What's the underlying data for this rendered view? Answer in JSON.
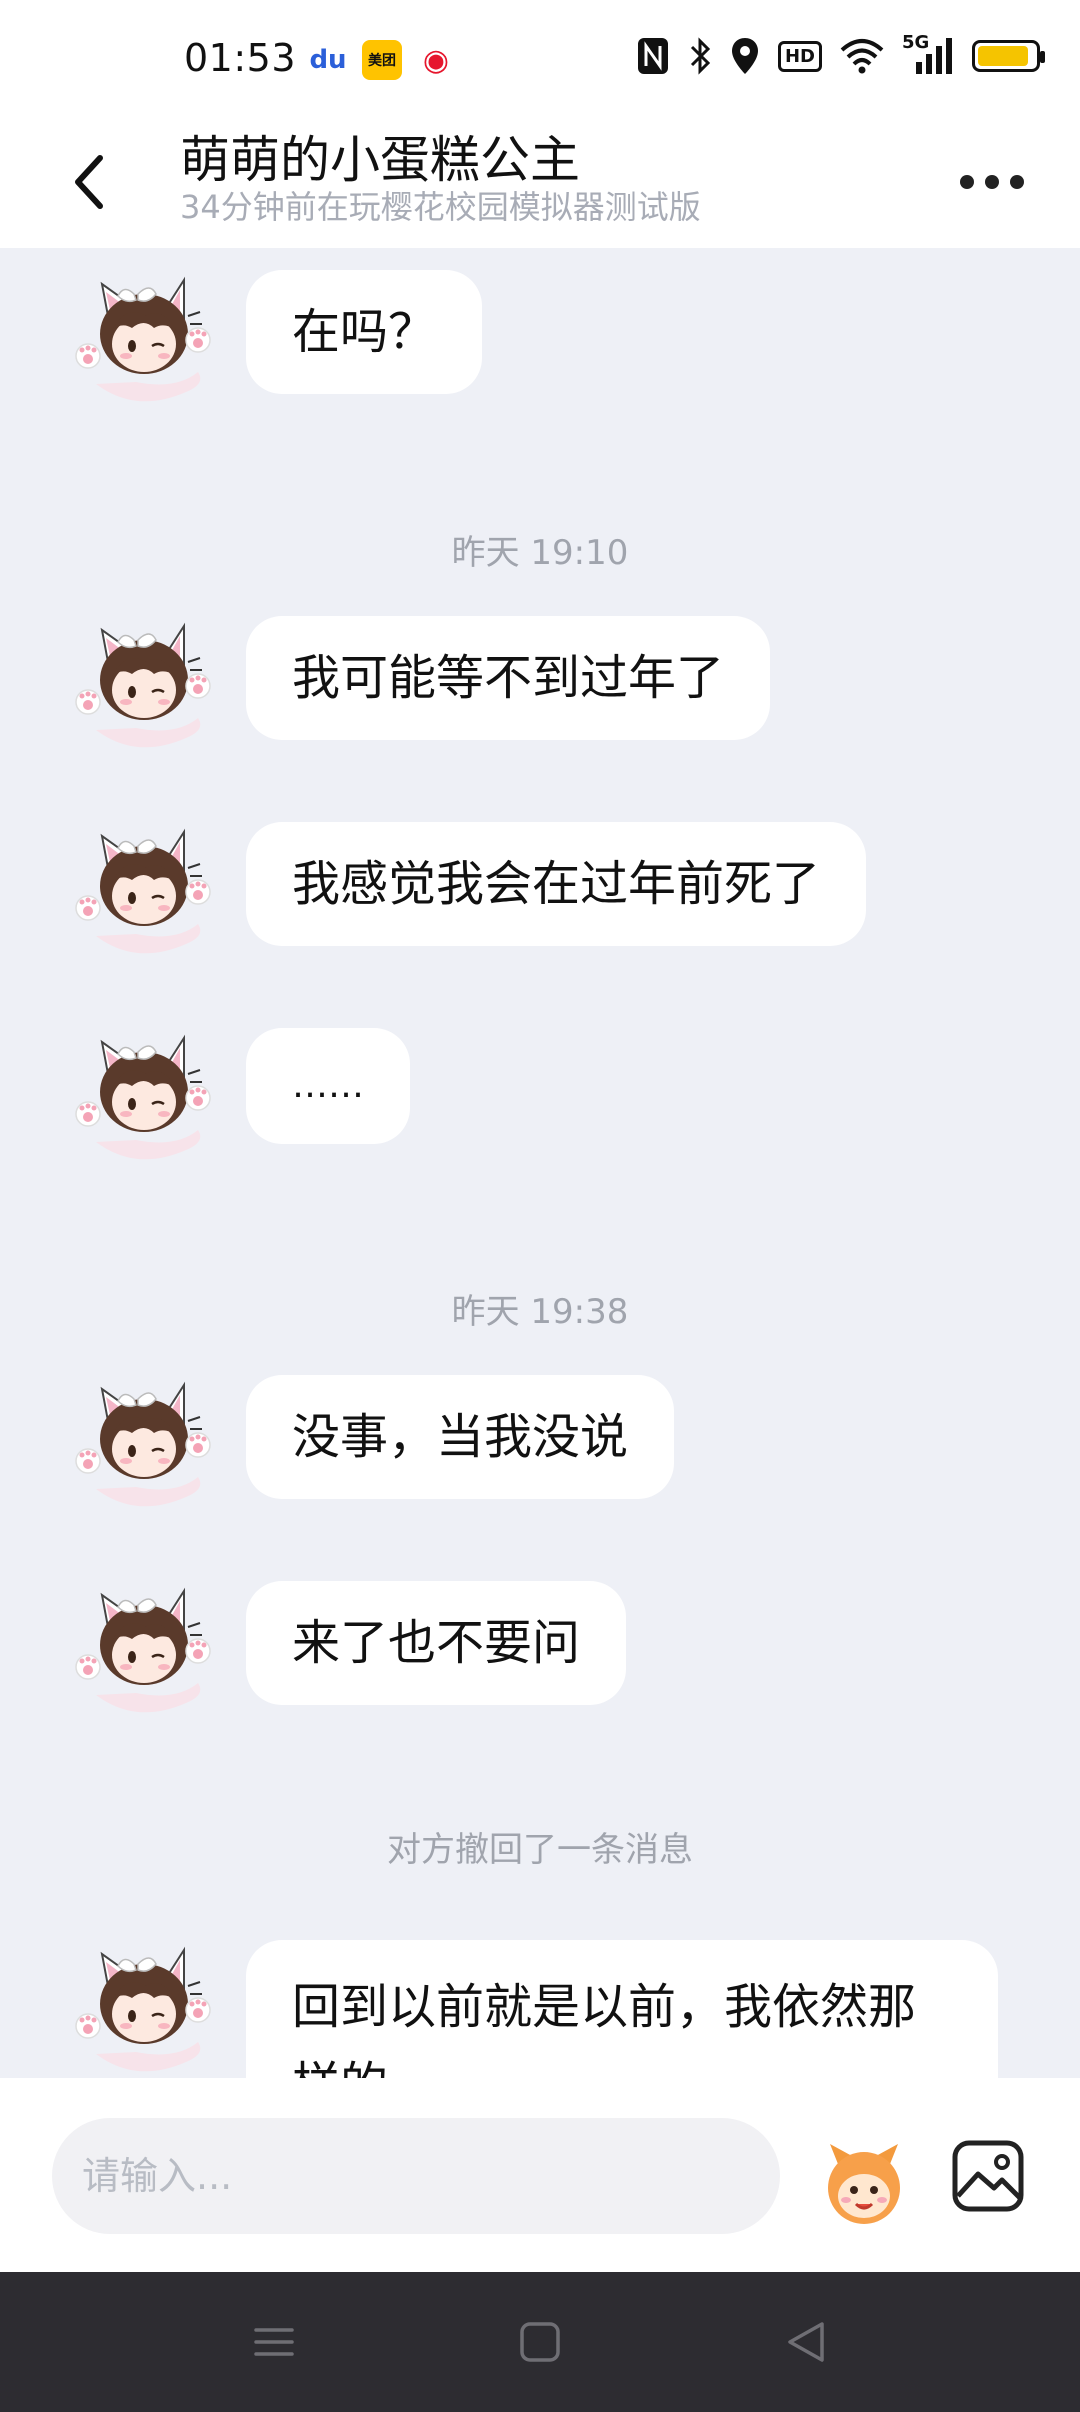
{
  "status_bar": {
    "time": "01:53",
    "app_icons": [
      {
        "name": "baidu",
        "glyph": "du"
      },
      {
        "name": "meituan",
        "glyph": "美团"
      },
      {
        "name": "weibo",
        "glyph": "◉"
      }
    ],
    "icons": [
      "nfc-icon",
      "bluetooth-icon",
      "location-icon",
      "hd-icon",
      "wifi-icon",
      "signal-5g-icon",
      "battery-icon"
    ],
    "hd_label": "HD",
    "network_label": "5G",
    "battery_level": 0.9,
    "battery_color": "#f5c400"
  },
  "header": {
    "title": "萌萌的小蛋糕公主",
    "subtitle": "34分钟前在玩樱花校园模拟器测试版"
  },
  "messages": [
    {
      "type": "bubble",
      "text": "在吗？"
    },
    {
      "type": "time",
      "text": "昨天 19:10"
    },
    {
      "type": "bubble",
      "text": "我可能等不到过年了"
    },
    {
      "type": "bubble",
      "text": "我感觉我会在过年前死了"
    },
    {
      "type": "bubble",
      "text": "……"
    },
    {
      "type": "time",
      "text": "昨天 19:38"
    },
    {
      "type": "bubble",
      "text": "没事，当我没说"
    },
    {
      "type": "bubble",
      "text": "来了也不要问"
    },
    {
      "type": "system",
      "text": "对方撤回了一条消息"
    },
    {
      "type": "bubble",
      "text": "回到以前就是以前，我依然那样的"
    }
  ],
  "input": {
    "placeholder": "请输入..."
  },
  "colors": {
    "background": "#eef0f6",
    "bubble": "#ffffff",
    "secondary_text": "#a0a4ad",
    "nav_bar": "#2d2c31"
  }
}
